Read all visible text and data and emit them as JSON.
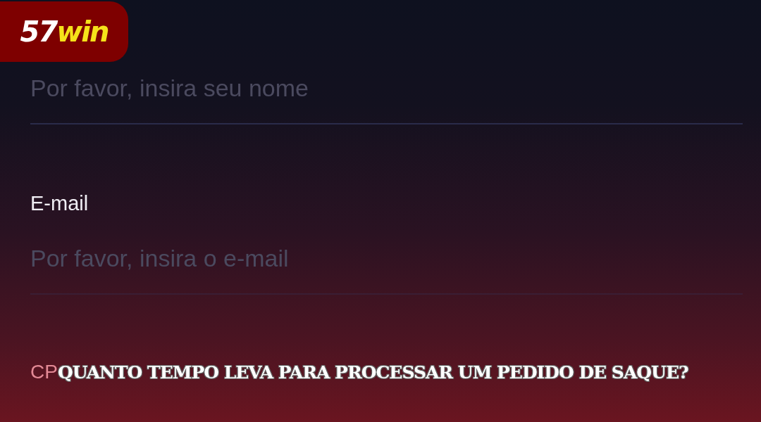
{
  "logo": {
    "number": "57",
    "word": "win"
  },
  "fields": [
    {
      "placeholder": "Por favor, insira seu nome"
    },
    {
      "label": "E-mail",
      "placeholder": "Por favor, insira o e-mail"
    }
  ],
  "cut_label": "CP",
  "caption": "QUANTO TEMPO LEVA PARA PROCESSAR UM PEDIDO DE SAQUE?"
}
